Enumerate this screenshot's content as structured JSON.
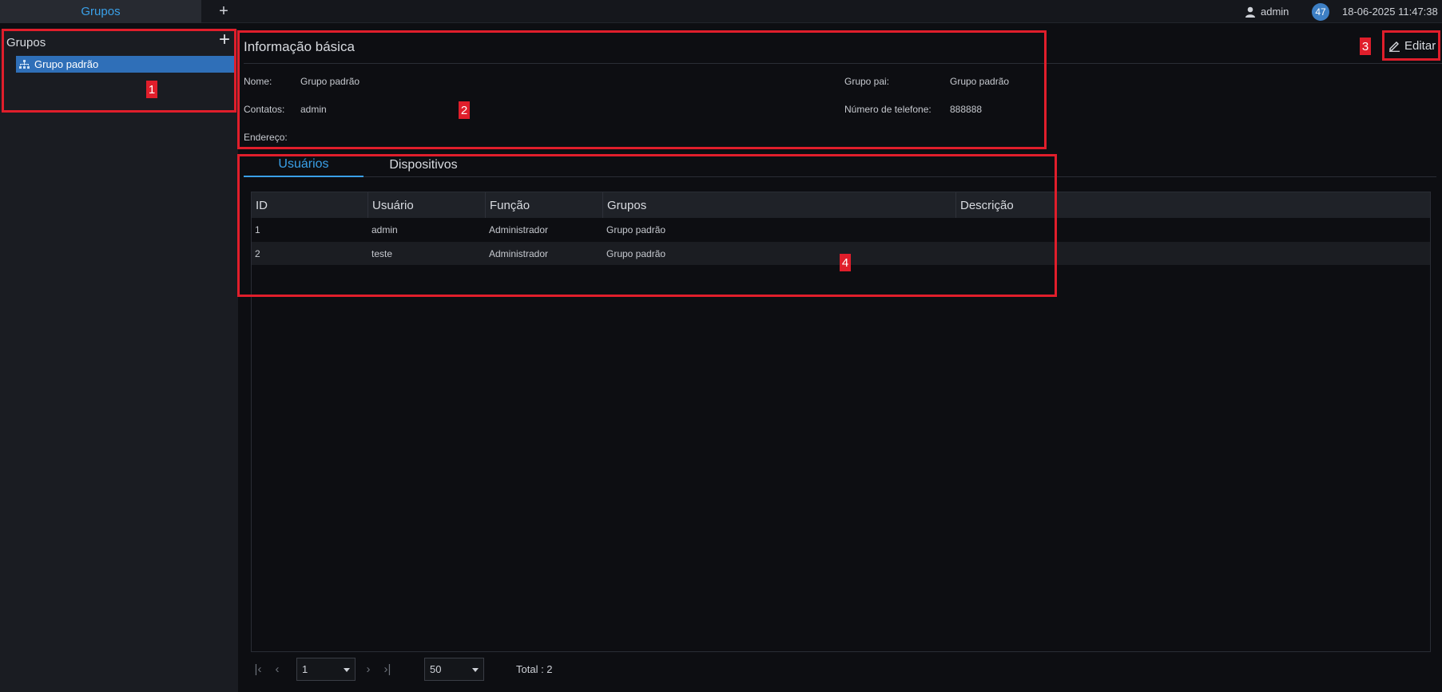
{
  "topbar": {
    "tab_label": "Grupos",
    "add_tab_label": "+",
    "user_name": "admin",
    "notification_count": "47",
    "datetime": "18-06-2025 11:47:38"
  },
  "sidebar": {
    "title": "Grupos",
    "add_label": "+",
    "tree": [
      {
        "label": "Grupo padrão",
        "selected": true
      }
    ]
  },
  "info": {
    "title": "Informação básica",
    "edit_label": "Editar",
    "fields": {
      "name_label": "Nome:",
      "name_value": "Grupo padrão",
      "contacts_label": "Contatos:",
      "contacts_value": "admin",
      "address_label": "Endereço:",
      "address_value": "",
      "parent_label": "Grupo pai:",
      "parent_value": "Grupo padrão",
      "phone_label": "Número de telefone:",
      "phone_value": "888888"
    }
  },
  "tabs": [
    {
      "label": "Usuários",
      "active": true
    },
    {
      "label": "Dispositivos",
      "active": false
    }
  ],
  "table": {
    "columns": [
      "ID",
      "Usuário",
      "Função",
      "Grupos",
      "Descrição"
    ],
    "rows": [
      [
        "1",
        "admin",
        "Administrador",
        "Grupo padrão",
        ""
      ],
      [
        "2",
        "teste",
        "Administrador",
        "Grupo padrão",
        ""
      ]
    ]
  },
  "pagination": {
    "page": "1",
    "page_size": "50",
    "total_text": "Total : 2"
  },
  "annotations": [
    "1",
    "2",
    "3",
    "4"
  ],
  "colors": {
    "accent": "#3aa0e8",
    "selected_bg": "#2f6fb8",
    "annotation": "#e01e2b"
  }
}
